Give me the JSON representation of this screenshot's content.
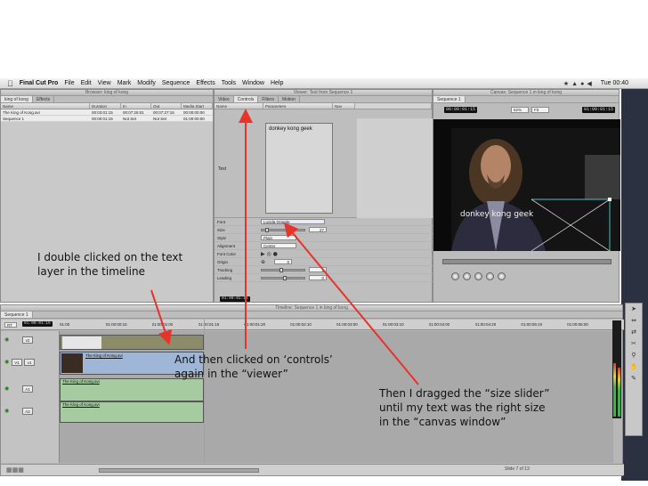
{
  "menubar": {
    "app": "Final Cut Pro",
    "items": [
      "File",
      "Edit",
      "View",
      "Mark",
      "Modify",
      "Sequence",
      "Effects",
      "Tools",
      "Window",
      "Help"
    ],
    "clock": "Tue 00:40"
  },
  "browser": {
    "title": "Browser: king of kong",
    "tabs": [
      "king of kong",
      "Effects"
    ],
    "columns": [
      "Name",
      "Duration",
      "In",
      "Out",
      "Media Start"
    ],
    "rows": [
      [
        "The King of Kong.avi",
        "00:03:01:15",
        "00:07:26:01",
        "00:07:27:15",
        "00:00:00:00"
      ],
      [
        "Sequence 1",
        "00:00:01:15",
        "Not Set",
        "Not Set",
        "01:00:00:00"
      ]
    ]
  },
  "viewer": {
    "title": "Viewer: Text from Sequence 1",
    "tabs": [
      "Video",
      "Controls",
      "Filters",
      "Motion"
    ],
    "columns": [
      "Name",
      "Parameters",
      "Nav"
    ],
    "text_label": "Text",
    "text_value": "donkey kong geek",
    "params": [
      {
        "name": "Font",
        "value": "Lucida Grande"
      },
      {
        "name": "Size",
        "value": "27"
      },
      {
        "name": "Style",
        "value": "Plain"
      },
      {
        "name": "Alignment",
        "value": "Center"
      },
      {
        "name": "Font Color",
        "value": ""
      },
      {
        "name": "Origin",
        "value": "0"
      },
      {
        "name": "Tracking",
        "value": "1"
      },
      {
        "name": "Leading",
        "value": "0"
      }
    ],
    "timecode": "01:00:01:15"
  },
  "canvas": {
    "title": "Canvas: Sequence 1 in king of kong",
    "tab": "Sequence 1",
    "timecode_left": "00:00:01:15",
    "zoom": "52%",
    "view": "Fit",
    "timecode_right": "01:00:01:15",
    "overlay_text": "donkey kong geek"
  },
  "timeline": {
    "title": "Timeline: Sequence 1 in king of kong",
    "tab": "Sequence 1",
    "rt": "RT",
    "timecode": "01:00:01:15",
    "ruler": [
      "01:00",
      "01:00:00:15",
      "01:00:01:00",
      "01:00:01:15",
      "01:00:01:20",
      "01:00:02:10",
      "01:00:03:00",
      "01:00:03:10",
      "01:00:04:00",
      "01:00:04:20",
      "01:00:05:10",
      "01:00:06:00"
    ],
    "tracks": [
      "v2",
      "v1",
      "A1",
      "A2"
    ],
    "track_targets": [
      "V1",
      "a1",
      "a2"
    ],
    "clip_name": "The King of Kong.avi"
  },
  "slide_indicator": "Slide 7 of 13",
  "annotations": {
    "note1": [
      "I double clicked on the text",
      "layer in the timeline"
    ],
    "note2": [
      "And then clicked on ‘controls’",
      "again in the “viewer”"
    ],
    "note3": [
      "Then I dragged the “size slider”",
      "until my text was the right size",
      "in the “canvas window”"
    ]
  },
  "colors": {
    "arrow": "#e8322c",
    "text_clip": "#8c8c6a",
    "video_clip": "#9fb6d6",
    "audio_clip": "#a7cba0",
    "selection_box": "#49c0c6"
  }
}
